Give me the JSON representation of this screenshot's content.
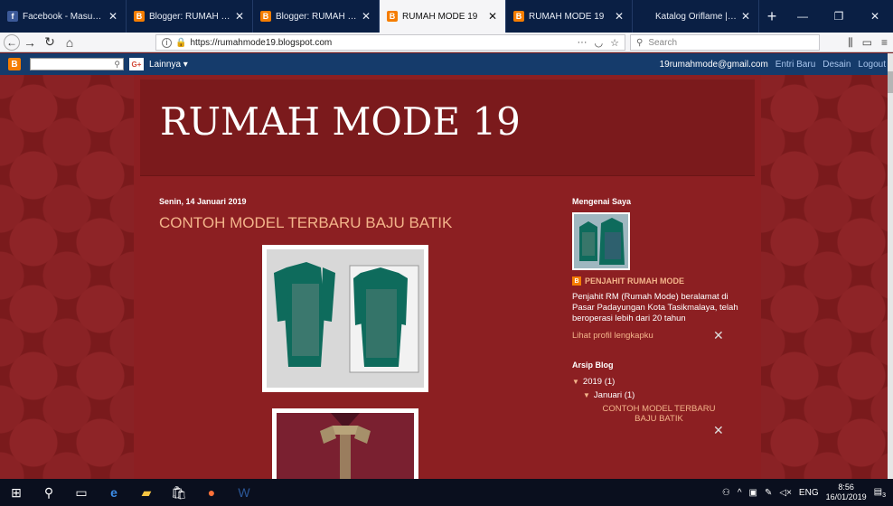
{
  "tabs": [
    {
      "title": "Facebook - Masuk atau D",
      "favicon": "facebook-favicon",
      "active": false
    },
    {
      "title": "Blogger: RUMAH MODE",
      "favicon": "blogger-favicon",
      "active": false
    },
    {
      "title": "Blogger: RUMAH MODE",
      "favicon": "blogger-favicon",
      "active": false
    },
    {
      "title": "RUMAH MODE 19",
      "favicon": "blogger-favicon",
      "active": true
    },
    {
      "title": "RUMAH MODE 19",
      "favicon": "blogger-favicon",
      "active": false
    },
    {
      "title": "Katalog Oriflame | Orifla",
      "favicon": "oriflame-favicon",
      "active": false
    }
  ],
  "navbar": {
    "url": "https://rumahmode19.blogspot.com",
    "search_placeholder": "Search"
  },
  "blogger_bar": {
    "more_label": "Lainnya ▾",
    "email": "19rumahmode@gmail.com",
    "new_entry": "Entri Baru",
    "design": "Desain",
    "logout": "Logout"
  },
  "blog": {
    "title": "RUMAH MODE 19",
    "post_date": "Senin, 14 Januari 2019",
    "post_title": "CONTOH MODEL TERBARU BAJU BATIK"
  },
  "sidebar": {
    "about_heading": "Mengenai Saya",
    "profile_name": "PENJAHIT RUMAH MODE",
    "profile_desc": "Penjahit RM (Rumah Mode) beralamat di Pasar Padayungan Kota Tasikmalaya, telah beroperasi lebih dari 20 tahun",
    "profile_link": "Lihat profil lengkapku",
    "archive_heading": "Arsip Blog",
    "archive_year": "2019 (1)",
    "archive_month": "Januari (1)",
    "archive_post": "CONTOH MODEL TERBARU BAJU BATIK"
  },
  "taskbar": {
    "lang": "ENG",
    "time": "8:56",
    "date": "16/01/2019",
    "notif_count": "3"
  },
  "colors": {
    "page_bg": "#7a1a1c",
    "content_bg": "#8c1f22",
    "accent_link": "#f3b48a",
    "blogger_bar": "#153b6b",
    "tab_strip": "#0a1f44"
  }
}
